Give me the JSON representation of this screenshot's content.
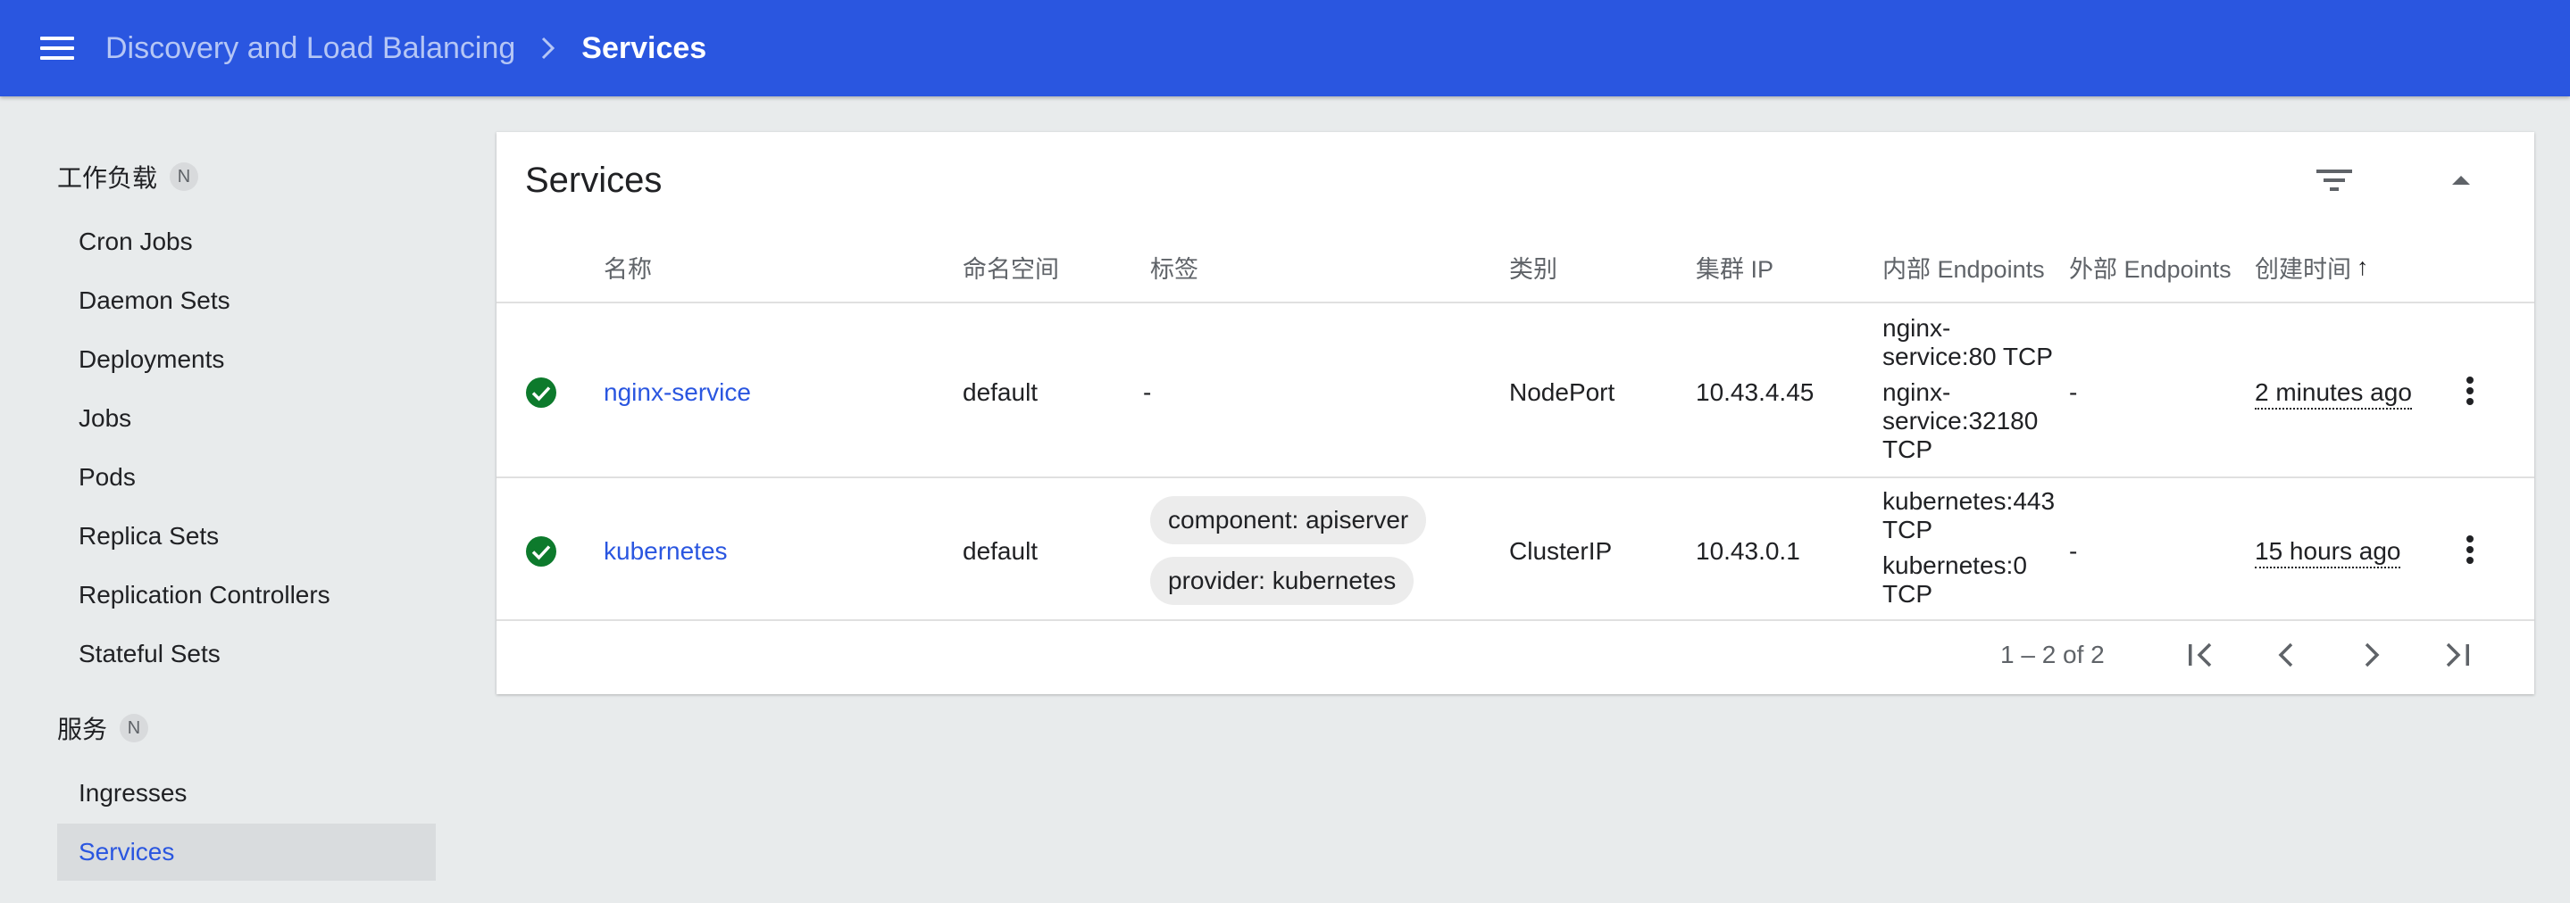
{
  "header": {
    "parent": "Discovery and Load Balancing",
    "current": "Services"
  },
  "sidebar": {
    "workloads": {
      "title": "工作负载",
      "badge": "N",
      "items": [
        "Cron Jobs",
        "Daemon Sets",
        "Deployments",
        "Jobs",
        "Pods",
        "Replica Sets",
        "Replication Controllers",
        "Stateful Sets"
      ]
    },
    "services": {
      "title": "服务",
      "badge": "N",
      "items": [
        "Ingresses",
        "Services"
      ],
      "active": "Services"
    }
  },
  "card": {
    "title": "Services",
    "columns": [
      "名称",
      "命名空间",
      "标签",
      "类别",
      "集群 IP",
      "内部 Endpoints",
      "外部 Endpoints",
      "创建时间"
    ],
    "sort_column": "创建时间",
    "sort_arrow": "↑",
    "rows": [
      {
        "status": "ok",
        "name": "nginx-service",
        "namespace": "default",
        "labels": "-",
        "type": "NodePort",
        "cluster_ip": "10.43.4.45",
        "internal_endpoints": [
          "nginx-service:80 TCP",
          "nginx-service:32180 TCP"
        ],
        "external_endpoints": "-",
        "created": "2 minutes ago"
      },
      {
        "status": "ok",
        "name": "kubernetes",
        "namespace": "default",
        "labels": [
          "component: apiserver",
          "provider: kubernetes"
        ],
        "type": "ClusterIP",
        "cluster_ip": "10.43.0.1",
        "internal_endpoints": [
          "kubernetes:443 TCP",
          "kubernetes:0 TCP"
        ],
        "external_endpoints": "-",
        "created": "15 hours ago"
      }
    ],
    "pagination": "1 – 2 of 2"
  },
  "colors": {
    "brand": "#2a56e0",
    "status_ok": "#0d7a2c",
    "background": "#e8ebec"
  }
}
